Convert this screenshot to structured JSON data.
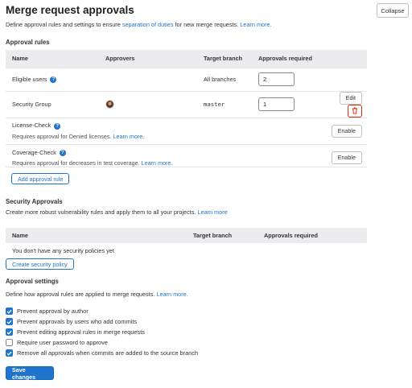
{
  "header": {
    "title": "Merge request approvals",
    "collapse_label": "Collapse",
    "desc_prefix": "Define approval rules and settings to ensure ",
    "desc_link": "separation of duties",
    "desc_suffix": " for new merge requests. ",
    "learn_more": "Learn more."
  },
  "approval_rules": {
    "section_title": "Approval rules",
    "columns": [
      "Name",
      "Approvers",
      "Target branch",
      "Approvals required"
    ],
    "rows": [
      {
        "name": "Eligible users",
        "target_branch": "All branches",
        "approvals": "2"
      },
      {
        "name": "Security Group",
        "target_branch": "master",
        "approvals": "1",
        "edit_label": "Edit"
      },
      {
        "name": "License-Check",
        "sub_text": "Requires approval for Denied licenses. ",
        "sub_link": "Learn more.",
        "action_label": "Enable"
      },
      {
        "name": "Coverage-Check",
        "sub_text": "Requires approval for decreases in test coverage. ",
        "sub_link": "Learn more.",
        "action_label": "Enable"
      }
    ],
    "add_rule_label": "Add approval rule"
  },
  "security_approvals": {
    "section_title": "Security Approvals",
    "desc": "Create more robust vulnerability rules and apply them to all your projects. ",
    "learn_more": "Learn more",
    "columns": [
      "Name",
      "Target branch",
      "Approvals required"
    ],
    "empty_text": "You don't have any security policies yet",
    "create_label": "Create security policy"
  },
  "approval_settings": {
    "section_title": "Approval settings",
    "desc": "Define how approval rules are applied to merge requests. ",
    "learn_more": "Learn more.",
    "options": [
      {
        "label": "Prevent approval by author",
        "checked": true
      },
      {
        "label": "Prevent approvals by users who add commits",
        "checked": true
      },
      {
        "label": "Prevent editing approval rules in merge requests",
        "checked": true
      },
      {
        "label": "Require user password to approve",
        "checked": false
      },
      {
        "label": "Remove all approvals when commits are added to the source branch",
        "checked": true
      }
    ],
    "save_label": "Save changes"
  },
  "colors": {
    "accent": "#1f75cb",
    "danger": "#dd2b0e",
    "header_bg": "#ececef"
  },
  "icons": {
    "help": "question-circle-icon",
    "delete": "trash-icon",
    "check": "checkmark-icon"
  }
}
